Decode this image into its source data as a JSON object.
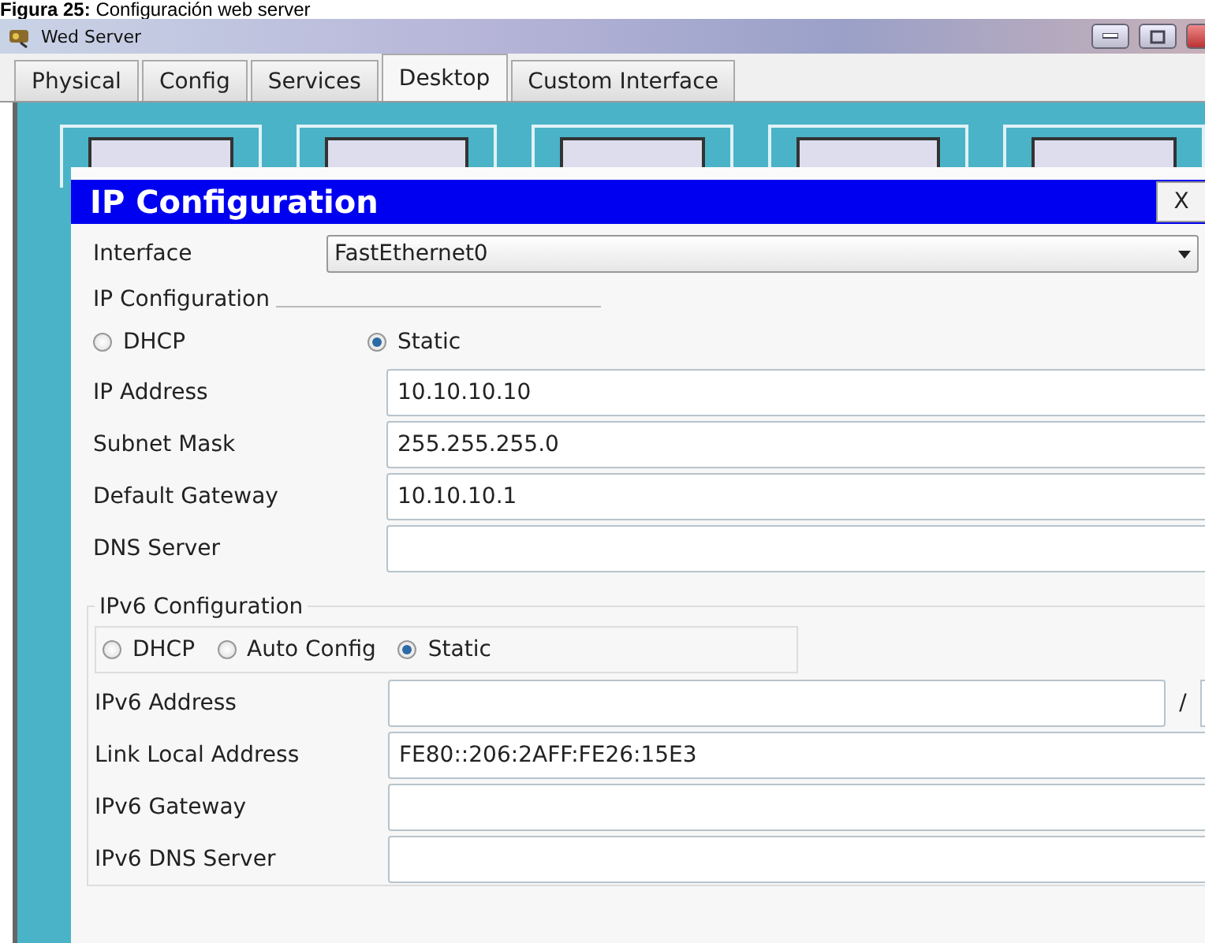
{
  "caption": "**Figura 25:** Configuración web server",
  "window": {
    "title": "Wed Server"
  },
  "tabs": [
    {
      "label": "Physical",
      "selected": false
    },
    {
      "label": "Config",
      "selected": false
    },
    {
      "label": "Services",
      "selected": false
    },
    {
      "label": "Desktop",
      "selected": true
    },
    {
      "label": "Custom Interface",
      "selected": false
    }
  ],
  "dialog": {
    "title": "IP Configuration",
    "close": "X",
    "interface": {
      "label": "Interface",
      "value": "FastEthernet0"
    },
    "ipv4": {
      "title": "IP Configuration",
      "modes": [
        {
          "label": "DHCP",
          "selected": false
        },
        {
          "label": "Static",
          "selected": true
        }
      ],
      "fields": [
        {
          "label": "IP Address",
          "value": "10.10.10.10"
        },
        {
          "label": "Subnet Mask",
          "value": "255.255.255.0"
        },
        {
          "label": "Default Gateway",
          "value": "10.10.10.1"
        },
        {
          "label": "DNS Server"
        }
      ]
    },
    "ipv6": {
      "title": "IPv6 Configuration",
      "modes": [
        {
          "label": "DHCP",
          "selected": false
        },
        {
          "label": "Auto Config",
          "selected": false
        },
        {
          "label": "Static",
          "selected": true
        }
      ],
      "fields": [
        {
          "label": "IPv6 Address",
          "kind": "prefix",
          "separator": "/"
        },
        {
          "label": "Link Local Address",
          "value": "FE80::206:2AFF:FE26:15E3"
        },
        {
          "label": "IPv6 Gateway"
        },
        {
          "label": "IPv6 DNS Server"
        }
      ]
    }
  }
}
